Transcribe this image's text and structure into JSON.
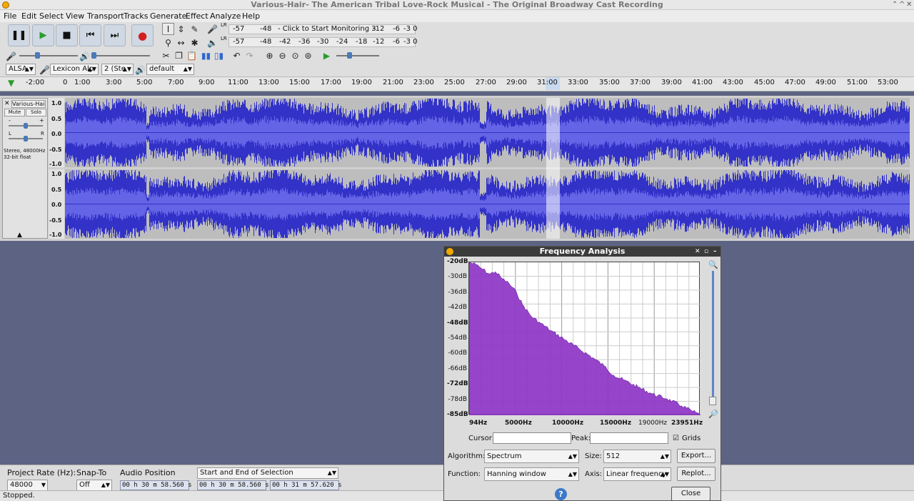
{
  "window": {
    "title": "Various-Hair- The American Tribal Love-Rock Musical - The Original Broadway Cast Recording",
    "controls": [
      "⌃",
      "^",
      "✕"
    ]
  },
  "menu": [
    "File",
    "Edit",
    "Select",
    "View",
    "Transport",
    "Tracks",
    "Generate",
    "Effect",
    "Analyze",
    "Help"
  ],
  "meters": {
    "record_row": [
      "-57",
      "-48",
      "- Click to Start Monitoring 3",
      "-12",
      "-6",
      "-3 0"
    ],
    "play_row": [
      "-57",
      "-48",
      "-42",
      "-36",
      "-30",
      "-24",
      "-18",
      "-12",
      "-6",
      "-3 0"
    ],
    "rec_channels": "LR",
    "play_channels": "LR"
  },
  "device": {
    "host": "ALSA",
    "mic": "Lexicon Alp",
    "channels": "2 (Ste",
    "speaker": "default"
  },
  "ruler": [
    "-2:00",
    "0",
    "1:00",
    "3:00",
    "5:00",
    "7:00",
    "9:00",
    "11:00",
    "13:00",
    "15:00",
    "17:00",
    "19:00",
    "21:00",
    "23:00",
    "25:00",
    "27:00",
    "29:00",
    "31:00",
    "33:00",
    "35:00",
    "37:00",
    "39:00",
    "41:00",
    "43:00",
    "45:00",
    "47:00",
    "49:00",
    "51:00",
    "53:00"
  ],
  "track": {
    "name": "Various-Hair",
    "mute": "Mute",
    "solo": "Solo",
    "gain_minus": "-",
    "gain_plus": "+",
    "pan_left": "L",
    "pan_right": "R",
    "info_line1": "Stereo, 48000Hz",
    "info_line2": "32-bit float",
    "collapse": "▲",
    "axis": [
      "1.0",
      "0.5",
      "0.0",
      "-0.5",
      "-1.0"
    ]
  },
  "bottom": {
    "rate_label": "Project Rate (Hz):",
    "rate_value": "48000",
    "snap_label": "Snap-To",
    "snap_value": "Off",
    "audio_pos_label": "Audio Position",
    "audio_pos": "00 h 30 m 58.560 s",
    "selection_mode": "Start and End of Selection",
    "sel_start": "00 h 30 m 58.560 s",
    "sel_end": "00 h 31 m 57.620 s"
  },
  "status": "Stopped.",
  "freq_dialog": {
    "title": "Frequency Analysis",
    "controls": [
      "✕",
      "▫",
      "–"
    ],
    "ylabels": [
      "-20dB",
      "-30dB",
      "-36dB",
      "-42dB",
      "-48dB",
      "-54dB",
      "-60dB",
      "-66dB",
      "-72dB",
      "-78dB",
      "-85dB"
    ],
    "xlabels": [
      "94Hz",
      "5000Hz",
      "10000Hz",
      "15000Hz",
      "19000Hz",
      "23951Hz"
    ],
    "cursor_label": "Cursor:",
    "peak_label": "Peak:",
    "grids_label": "Grids",
    "grids_checked": true,
    "algorithm_label": "Algorithm:",
    "algorithm_value": "Spectrum",
    "size_label": "Size:",
    "size_value": "512",
    "export_button": "Export...",
    "function_label": "Function:",
    "function_value": "Hanning window",
    "axis_label": "Axis:",
    "axis_value": "Linear frequency",
    "replot_button": "Replot...",
    "help": "?",
    "close_button": "Close",
    "spectrum_color": "#8d35c6"
  },
  "chart_data": {
    "type": "area",
    "x_unit": "Hz",
    "y_unit": "dB",
    "ylim": [
      -85,
      -20
    ],
    "xlim": [
      94,
      23951
    ],
    "grid": true,
    "x": [
      94,
      800,
      1500,
      2200,
      2800,
      3500,
      4200,
      5000,
      5600,
      6500,
      7500,
      8500,
      10000,
      11500,
      13000,
      14000,
      15000,
      16000,
      17500,
      19000,
      20500,
      22000,
      23000,
      23951
    ],
    "y": [
      -20,
      -21,
      -23,
      -25,
      -24,
      -27,
      -29,
      -33,
      -38,
      -43,
      -46,
      -49,
      -53,
      -57,
      -61,
      -64,
      -68,
      -70,
      -73,
      -76,
      -78,
      -81,
      -83,
      -85
    ]
  }
}
